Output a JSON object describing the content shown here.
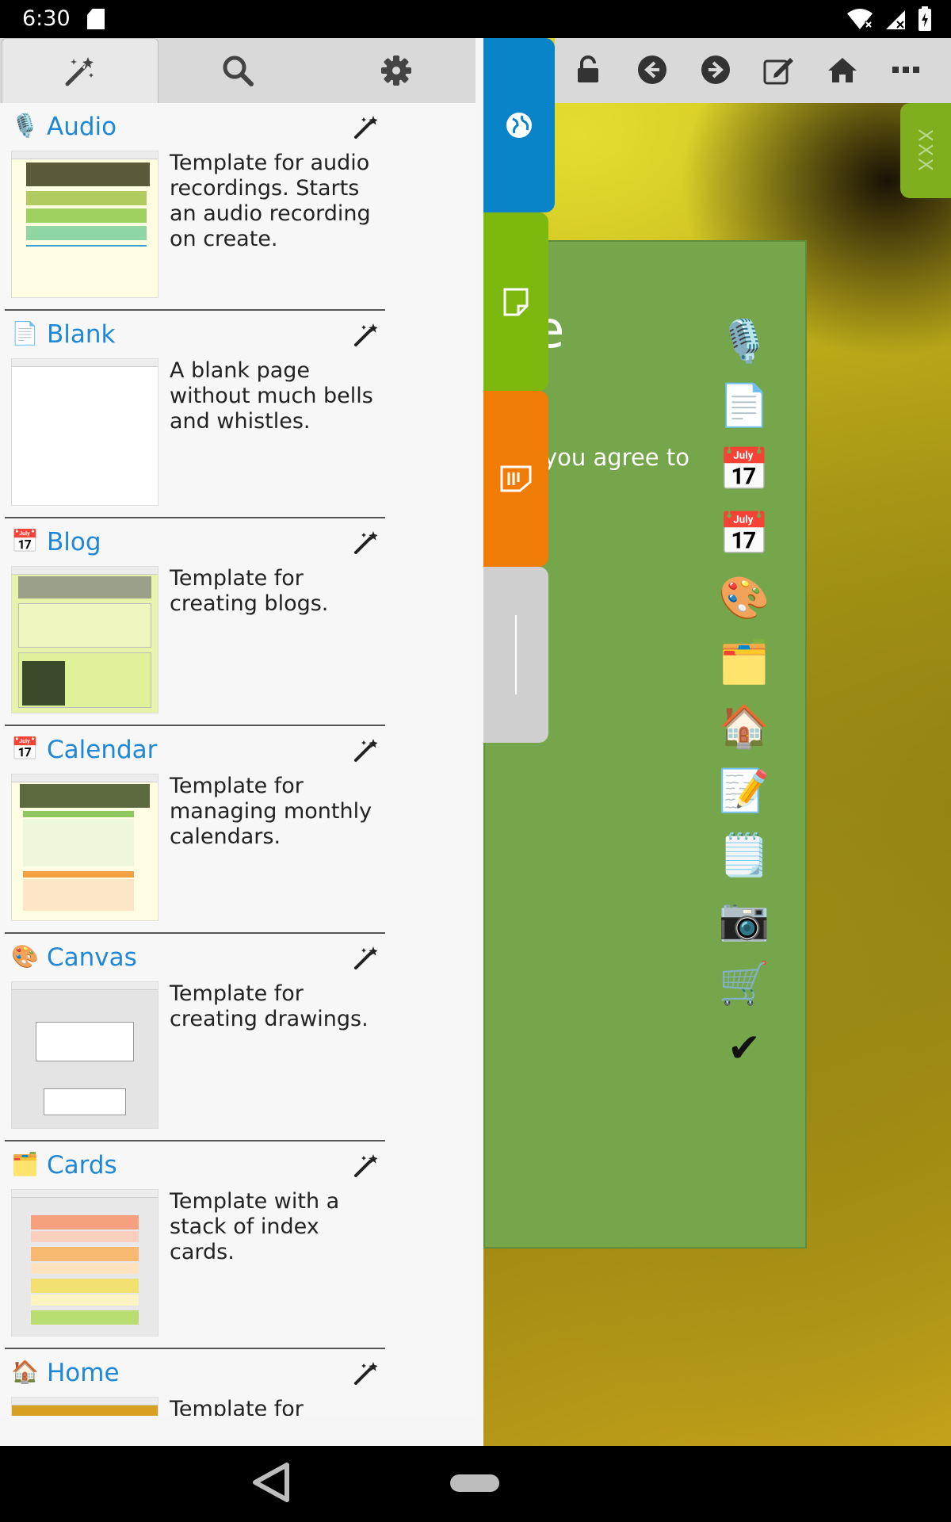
{
  "status_bar": {
    "time": "6:30"
  },
  "drawer": {
    "tabs": [
      {
        "icon": "wand-icon"
      },
      {
        "icon": "search-icon"
      },
      {
        "icon": "gear-icon"
      }
    ],
    "templates": [
      {
        "name": "Audio",
        "emoji": "🎙️",
        "description": "Template for audio recordings. Starts an audio recording on create."
      },
      {
        "name": "Blank",
        "emoji": "📄",
        "description": "A blank page without much bells and whistles."
      },
      {
        "name": "Blog",
        "emoji": "📅",
        "description": "Template for creating blogs."
      },
      {
        "name": "Calendar",
        "emoji": "📅",
        "description": "Template for managing monthly calendars."
      },
      {
        "name": "Canvas",
        "emoji": "🎨",
        "description": "Template for creating drawings."
      },
      {
        "name": "Cards",
        "emoji": "🗂️",
        "description": "Template with a stack of index cards."
      },
      {
        "name": "Home",
        "emoji": "🏠",
        "description": "Template for home/index page."
      }
    ]
  },
  "toolbar": {
    "buttons": [
      "unlock-icon",
      "back-icon",
      "forward-icon",
      "edit-icon",
      "home-icon",
      "more-icon"
    ]
  },
  "page": {
    "big_letter": "e",
    "text_fragment": "you agree to",
    "right_tab_label": "XXX"
  },
  "template_icons": [
    "🎙️",
    "📄",
    "📅",
    "📅",
    "🎨",
    "🗂️",
    "🏠",
    "📝",
    "🗒️",
    "📷",
    "🛒",
    "✔"
  ]
}
